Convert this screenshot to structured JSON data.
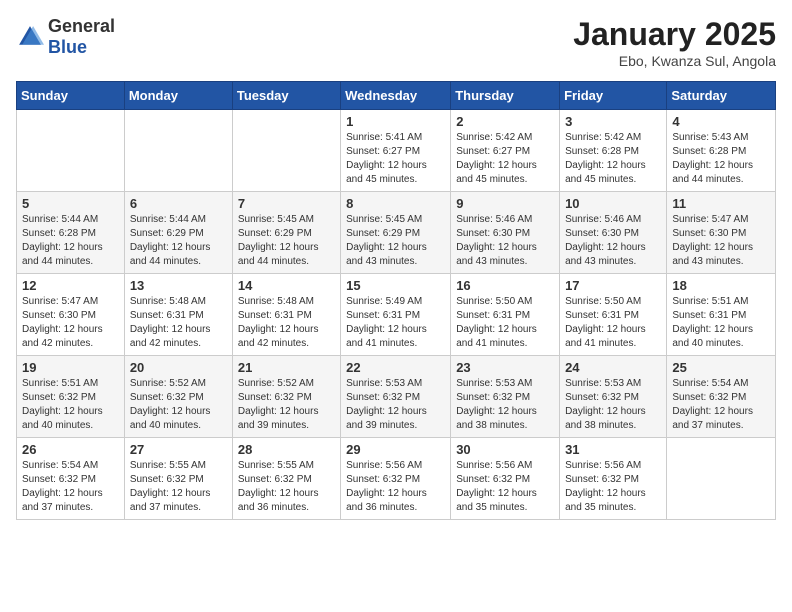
{
  "logo": {
    "general": "General",
    "blue": "Blue"
  },
  "title": "January 2025",
  "subtitle": "Ebo, Kwanza Sul, Angola",
  "days_of_week": [
    "Sunday",
    "Monday",
    "Tuesday",
    "Wednesday",
    "Thursday",
    "Friday",
    "Saturday"
  ],
  "weeks": [
    [
      {
        "day": "",
        "info": ""
      },
      {
        "day": "",
        "info": ""
      },
      {
        "day": "",
        "info": ""
      },
      {
        "day": "1",
        "info": "Sunrise: 5:41 AM\nSunset: 6:27 PM\nDaylight: 12 hours\nand 45 minutes."
      },
      {
        "day": "2",
        "info": "Sunrise: 5:42 AM\nSunset: 6:27 PM\nDaylight: 12 hours\nand 45 minutes."
      },
      {
        "day": "3",
        "info": "Sunrise: 5:42 AM\nSunset: 6:28 PM\nDaylight: 12 hours\nand 45 minutes."
      },
      {
        "day": "4",
        "info": "Sunrise: 5:43 AM\nSunset: 6:28 PM\nDaylight: 12 hours\nand 44 minutes."
      }
    ],
    [
      {
        "day": "5",
        "info": "Sunrise: 5:44 AM\nSunset: 6:28 PM\nDaylight: 12 hours\nand 44 minutes."
      },
      {
        "day": "6",
        "info": "Sunrise: 5:44 AM\nSunset: 6:29 PM\nDaylight: 12 hours\nand 44 minutes."
      },
      {
        "day": "7",
        "info": "Sunrise: 5:45 AM\nSunset: 6:29 PM\nDaylight: 12 hours\nand 44 minutes."
      },
      {
        "day": "8",
        "info": "Sunrise: 5:45 AM\nSunset: 6:29 PM\nDaylight: 12 hours\nand 43 minutes."
      },
      {
        "day": "9",
        "info": "Sunrise: 5:46 AM\nSunset: 6:30 PM\nDaylight: 12 hours\nand 43 minutes."
      },
      {
        "day": "10",
        "info": "Sunrise: 5:46 AM\nSunset: 6:30 PM\nDaylight: 12 hours\nand 43 minutes."
      },
      {
        "day": "11",
        "info": "Sunrise: 5:47 AM\nSunset: 6:30 PM\nDaylight: 12 hours\nand 43 minutes."
      }
    ],
    [
      {
        "day": "12",
        "info": "Sunrise: 5:47 AM\nSunset: 6:30 PM\nDaylight: 12 hours\nand 42 minutes."
      },
      {
        "day": "13",
        "info": "Sunrise: 5:48 AM\nSunset: 6:31 PM\nDaylight: 12 hours\nand 42 minutes."
      },
      {
        "day": "14",
        "info": "Sunrise: 5:48 AM\nSunset: 6:31 PM\nDaylight: 12 hours\nand 42 minutes."
      },
      {
        "day": "15",
        "info": "Sunrise: 5:49 AM\nSunset: 6:31 PM\nDaylight: 12 hours\nand 41 minutes."
      },
      {
        "day": "16",
        "info": "Sunrise: 5:50 AM\nSunset: 6:31 PM\nDaylight: 12 hours\nand 41 minutes."
      },
      {
        "day": "17",
        "info": "Sunrise: 5:50 AM\nSunset: 6:31 PM\nDaylight: 12 hours\nand 41 minutes."
      },
      {
        "day": "18",
        "info": "Sunrise: 5:51 AM\nSunset: 6:31 PM\nDaylight: 12 hours\nand 40 minutes."
      }
    ],
    [
      {
        "day": "19",
        "info": "Sunrise: 5:51 AM\nSunset: 6:32 PM\nDaylight: 12 hours\nand 40 minutes."
      },
      {
        "day": "20",
        "info": "Sunrise: 5:52 AM\nSunset: 6:32 PM\nDaylight: 12 hours\nand 40 minutes."
      },
      {
        "day": "21",
        "info": "Sunrise: 5:52 AM\nSunset: 6:32 PM\nDaylight: 12 hours\nand 39 minutes."
      },
      {
        "day": "22",
        "info": "Sunrise: 5:53 AM\nSunset: 6:32 PM\nDaylight: 12 hours\nand 39 minutes."
      },
      {
        "day": "23",
        "info": "Sunrise: 5:53 AM\nSunset: 6:32 PM\nDaylight: 12 hours\nand 38 minutes."
      },
      {
        "day": "24",
        "info": "Sunrise: 5:53 AM\nSunset: 6:32 PM\nDaylight: 12 hours\nand 38 minutes."
      },
      {
        "day": "25",
        "info": "Sunrise: 5:54 AM\nSunset: 6:32 PM\nDaylight: 12 hours\nand 37 minutes."
      }
    ],
    [
      {
        "day": "26",
        "info": "Sunrise: 5:54 AM\nSunset: 6:32 PM\nDaylight: 12 hours\nand 37 minutes."
      },
      {
        "day": "27",
        "info": "Sunrise: 5:55 AM\nSunset: 6:32 PM\nDaylight: 12 hours\nand 37 minutes."
      },
      {
        "day": "28",
        "info": "Sunrise: 5:55 AM\nSunset: 6:32 PM\nDaylight: 12 hours\nand 36 minutes."
      },
      {
        "day": "29",
        "info": "Sunrise: 5:56 AM\nSunset: 6:32 PM\nDaylight: 12 hours\nand 36 minutes."
      },
      {
        "day": "30",
        "info": "Sunrise: 5:56 AM\nSunset: 6:32 PM\nDaylight: 12 hours\nand 35 minutes."
      },
      {
        "day": "31",
        "info": "Sunrise: 5:56 AM\nSunset: 6:32 PM\nDaylight: 12 hours\nand 35 minutes."
      },
      {
        "day": "",
        "info": ""
      }
    ]
  ]
}
